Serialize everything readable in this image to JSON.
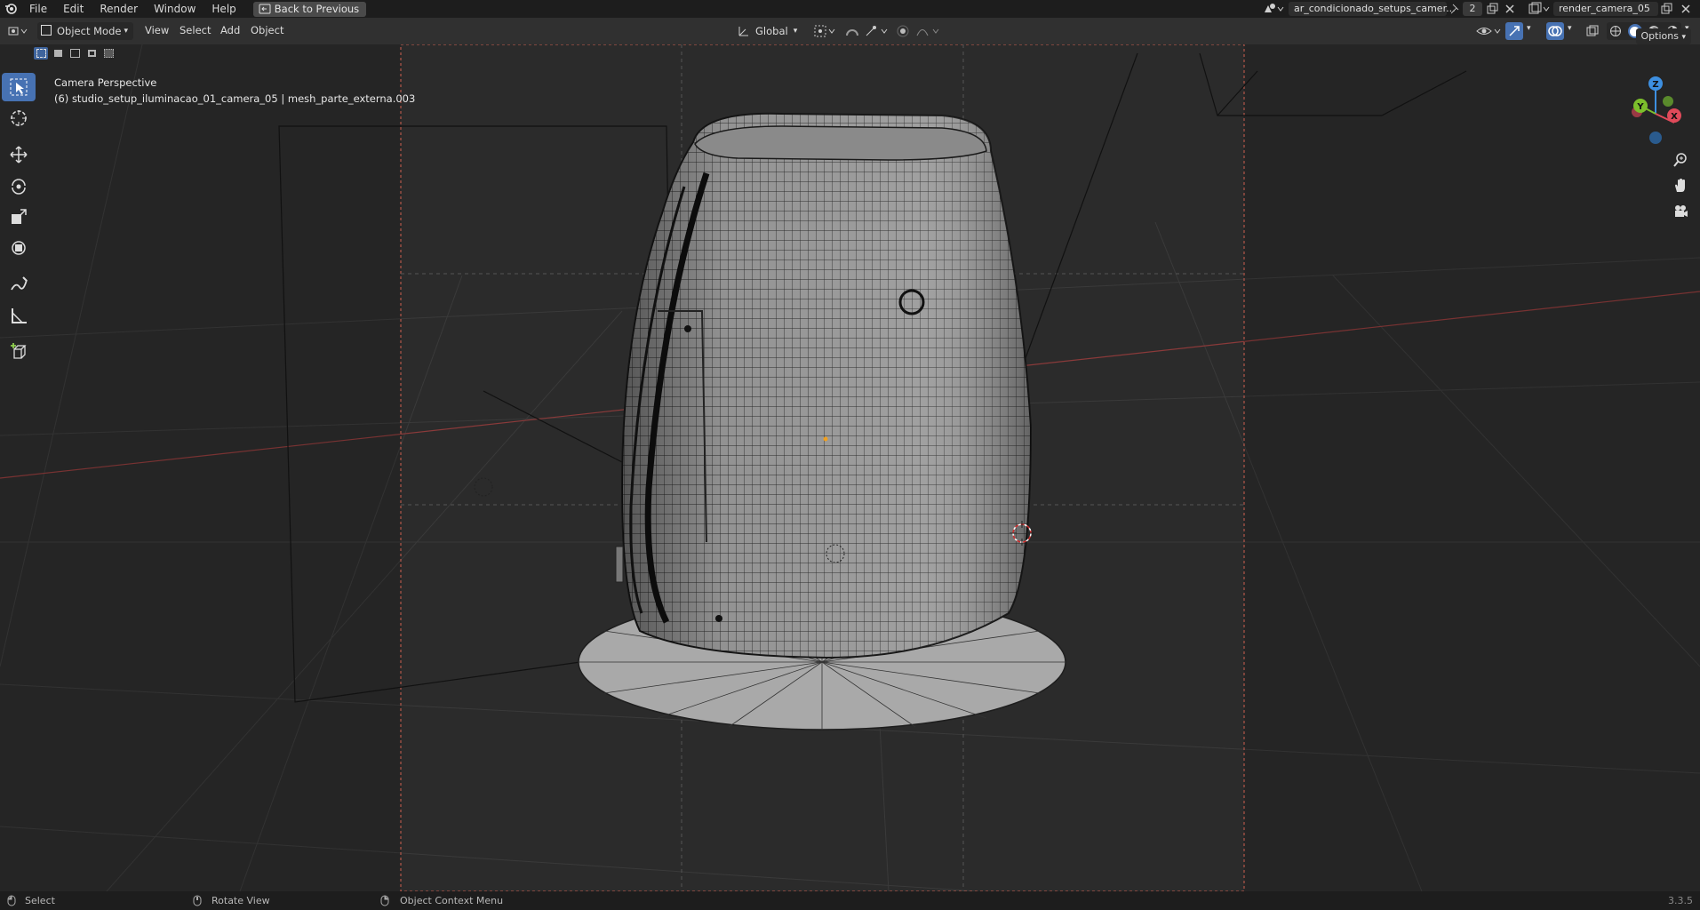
{
  "topbar": {
    "menus": [
      "File",
      "Edit",
      "Render",
      "Window",
      "Help"
    ],
    "back_label": "Back to Previous",
    "scene_name": "ar_condicionado_setups_camer...",
    "scene_users": "2",
    "view_layer": "render_camera_05"
  },
  "header": {
    "mode": "Object Mode",
    "menus": [
      "View",
      "Select",
      "Add",
      "Object"
    ],
    "orientation": "Global",
    "options_label": "Options"
  },
  "viewport": {
    "view_name": "Camera Perspective",
    "object_info": "(6) studio_setup_iluminacao_01_camera_05 | mesh_parte_externa.003"
  },
  "gizmo": {
    "x_label": "X",
    "y_label": "Y",
    "z_label": "Z"
  },
  "statusbar": {
    "select_label": "Select",
    "rotate_label": "Rotate View",
    "context_label": "Object Context Menu",
    "version": "3.3.5"
  },
  "colors": {
    "accent": "#4772b3",
    "x_axis": "#e04a5a",
    "y_axis": "#7cbf2c",
    "z_axis": "#3d8fe0"
  }
}
